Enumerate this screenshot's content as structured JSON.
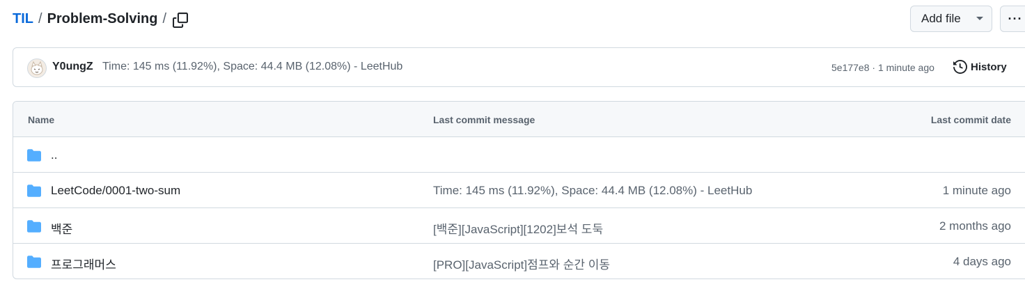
{
  "breadcrumb": {
    "root": "TIL",
    "separator": "/",
    "current": "Problem-Solving",
    "trailing": "/"
  },
  "actions": {
    "add_file": "Add file",
    "more": "···"
  },
  "latest_commit": {
    "author": "Y0ungZ",
    "message": "Time: 145 ms (11.92%), Space: 44.4 MB (12.08%) - LeetHub",
    "hash": "5e177e8",
    "dot": "·",
    "time": "1 minute ago",
    "history_label": "History"
  },
  "table": {
    "headers": {
      "name": "Name",
      "message": "Last commit message",
      "date": "Last commit date"
    },
    "rows": [
      {
        "name": "..",
        "message": "",
        "date": ""
      },
      {
        "name": "LeetCode/0001-two-sum",
        "message": "Time: 145 ms (11.92%), Space: 44.4 MB (12.08%) - LeetHub",
        "date": "1 minute ago"
      },
      {
        "name": "백준",
        "message": "[백준][JavaScript][1202]보석 도둑",
        "date": "2 months ago"
      },
      {
        "name": "프로그래머스",
        "message": "[PRO][JavaScript]점프와 순간 이동",
        "date": "4 days ago"
      }
    ]
  },
  "colors": {
    "link": "#0969da",
    "folder": "#54aeff",
    "muted": "#59636e",
    "border": "#d1d9e0",
    "header_bg": "#f6f8fa"
  },
  "icons": {
    "copy": "copy-icon",
    "folder": "folder-icon",
    "history": "history-icon",
    "caret": "triangle-down-icon"
  }
}
